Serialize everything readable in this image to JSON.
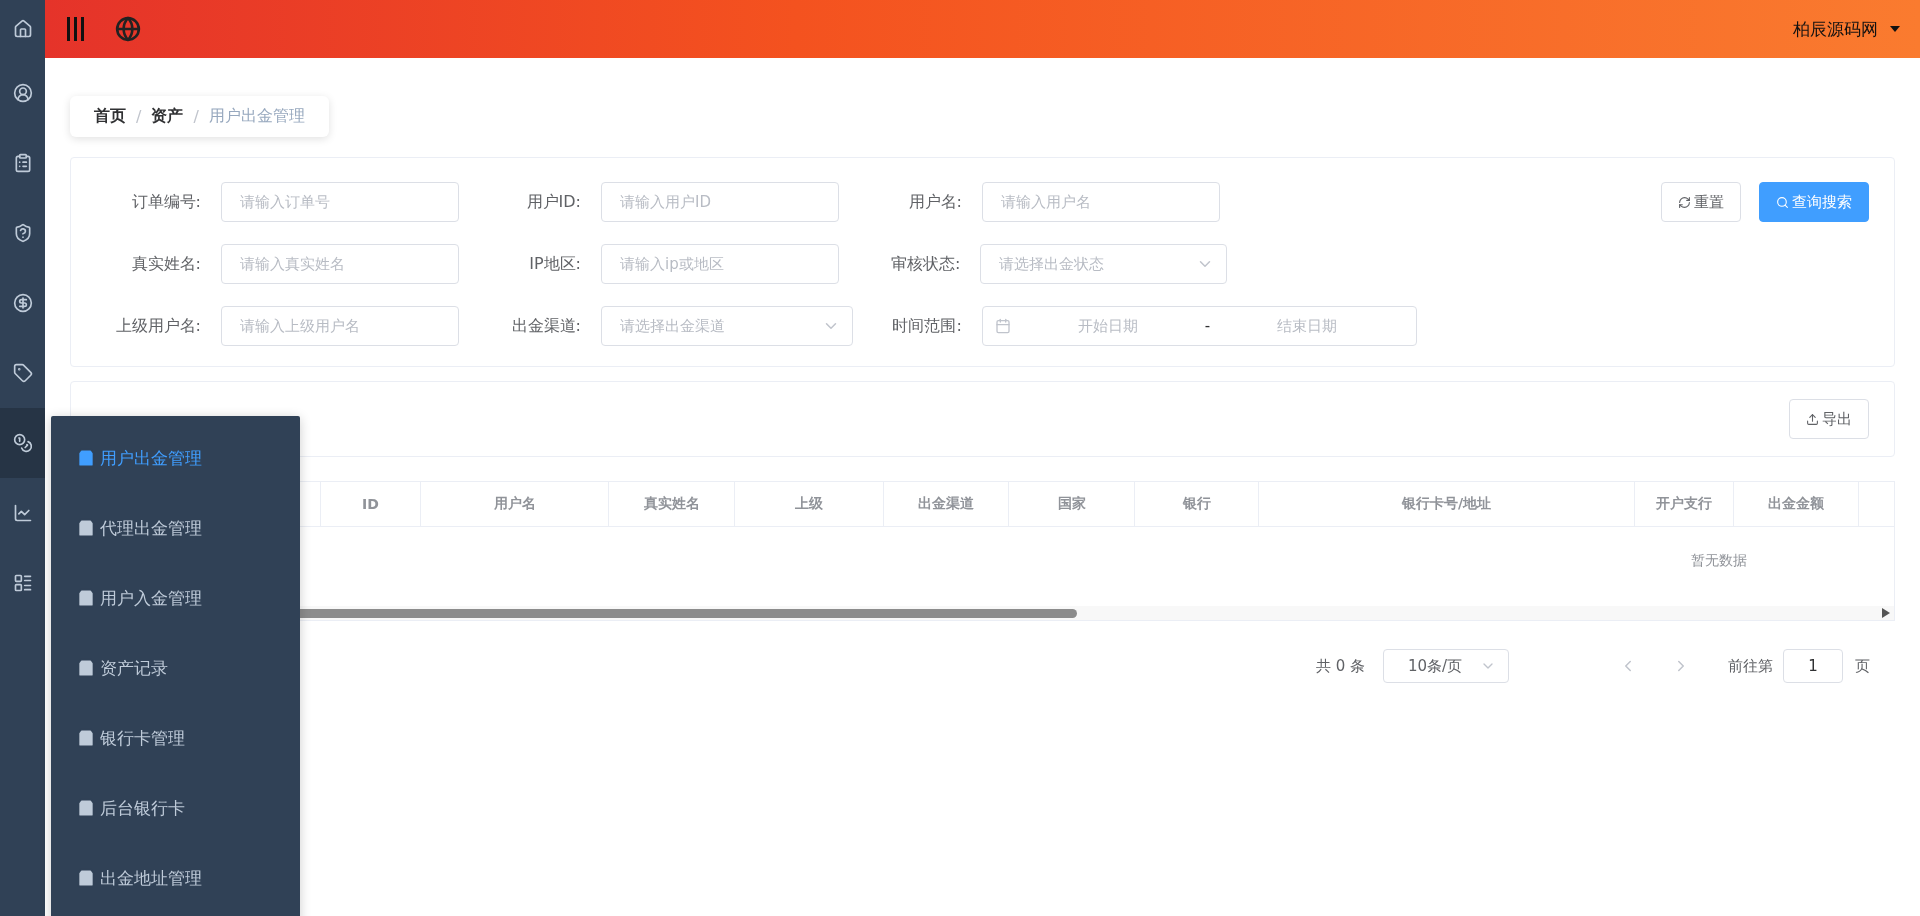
{
  "sidebar": {
    "items": [
      {
        "selected": false
      },
      {
        "selected": false
      },
      {
        "selected": false
      },
      {
        "selected": false
      },
      {
        "selected": false
      },
      {
        "selected": false
      },
      {
        "selected": true
      },
      {
        "selected": false
      },
      {
        "selected": false
      }
    ]
  },
  "topbar": {
    "user": "柏辰源码网"
  },
  "breadcrumb": [
    {
      "label": "首页",
      "current": false
    },
    {
      "label": "资产",
      "current": false
    },
    {
      "label": "用户出金管理",
      "current": true
    }
  ],
  "breadcrumb_separators": [
    "/",
    "/"
  ],
  "filters": [
    {
      "label": "订单编号:",
      "kind": "input",
      "placeholder": "请输入订单号"
    },
    {
      "label": "用户ID:",
      "kind": "input",
      "placeholder": "请输入用户ID"
    },
    {
      "label": "用户名:",
      "kind": "input",
      "placeholder": "请输入用户名"
    },
    {
      "label": "真实姓名:",
      "kind": "input",
      "placeholder": "请输入真实姓名"
    },
    {
      "label": "IP地区:",
      "kind": "input",
      "placeholder": "请输入ip或地区"
    },
    {
      "label": "审核状态:",
      "kind": "select",
      "placeholder": "请选择出金状态"
    },
    {
      "label": "上级用户名:",
      "kind": "input",
      "placeholder": "请输入上级用户名"
    },
    {
      "label": "出金渠道:",
      "kind": "select",
      "placeholder": "请选择出金渠道"
    },
    {
      "label": "时间范围:",
      "kind": "daterange",
      "start": "开始日期",
      "separator": "-",
      "end": "结束日期"
    }
  ],
  "filter_buttons": [
    {
      "label": "重置",
      "kind": "reset"
    },
    {
      "label": "查询搜索",
      "kind": "search"
    }
  ],
  "table_card": {
    "export": "导出"
  },
  "table": {
    "columns": [
      "ID",
      "用户名",
      "真实姓名",
      "上级",
      "出金渠道",
      "国家",
      "银行",
      "银行卡号/地址",
      "开户支行",
      "出金金额"
    ],
    "empty": "暂无数据"
  },
  "pagination": {
    "total": "共 0 条",
    "page_size": "10条/页",
    "goto": "前往第",
    "page": "1",
    "page_suffix": "页"
  },
  "flyout": [
    {
      "label": "用户出金管理",
      "selected": true
    },
    {
      "label": "代理出金管理",
      "selected": false
    },
    {
      "label": "用户入金管理",
      "selected": false
    },
    {
      "label": "资产记录",
      "selected": false
    },
    {
      "label": "银行卡管理",
      "selected": false
    },
    {
      "label": "后台银行卡",
      "selected": false
    },
    {
      "label": "出金地址管理",
      "selected": false
    }
  ]
}
